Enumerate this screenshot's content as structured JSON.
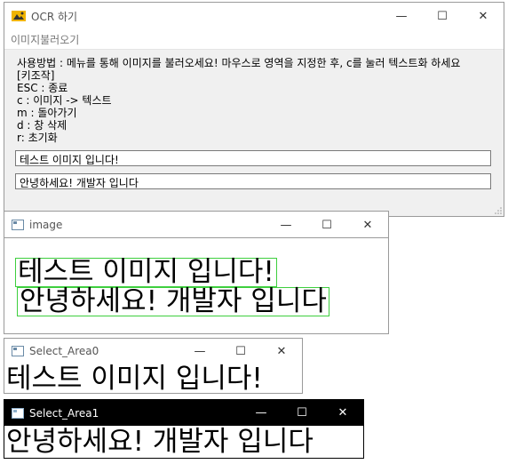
{
  "ocr_window": {
    "title": "OCR 하기",
    "menu": "이미지불러오기",
    "usage_lines": [
      "사용방법 : 메뉴를 통해 이미지를 불러오세요! 마우스로 영역을 지정한 후, c를 눌러 텍스트화 하세요",
      "[키조작]",
      "ESC : 종료",
      "c : 이미지 -> 텍스트",
      "m : 돌아가기",
      "d : 창 삭제",
      "r: 초기화"
    ],
    "result_fields": [
      "테스트 이미지 입니다!",
      "안녕하세요! 개발자 입니다"
    ]
  },
  "image_window": {
    "title": "image",
    "lines": [
      "테스트 이미지 입니다!",
      "안녕하세요! 개발자 입니다"
    ]
  },
  "select_windows": [
    {
      "title": "Select_Area0",
      "text": "테스트 이미지 입니다!"
    },
    {
      "title": "Select_Area1",
      "text": "안녕하세요! 개발자 입니다"
    }
  ],
  "controls": {
    "minimize": "—",
    "maximize": "☐",
    "close": "✕"
  },
  "colors": {
    "selection_box": "#3ecf3e",
    "active_titlebar": "#000000"
  },
  "icons": {
    "app": "ocr-app-icon",
    "image": "image-window-icon"
  }
}
